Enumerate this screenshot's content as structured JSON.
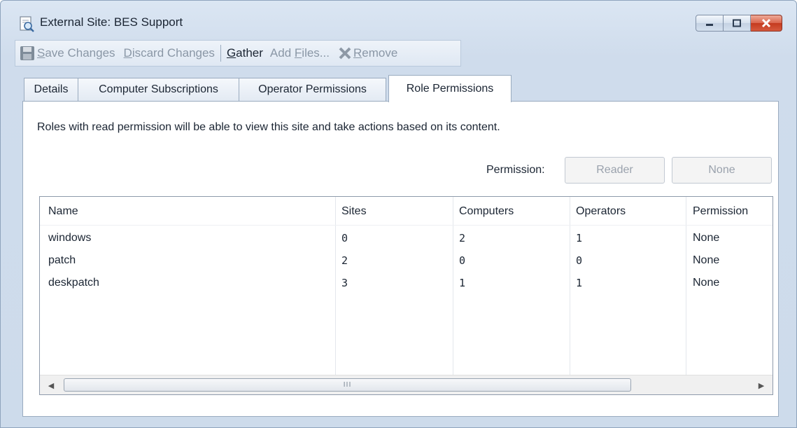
{
  "window": {
    "title": "External Site: BES Support"
  },
  "toolbar": {
    "save_label": "Save Changes",
    "discard_label": "Discard Changes",
    "gather_label": "Gather",
    "add_files_label": "Add Files...",
    "remove_label": "Remove"
  },
  "tabs": [
    {
      "label": "Details"
    },
    {
      "label": "Computer Subscriptions"
    },
    {
      "label": "Operator Permissions"
    },
    {
      "label": "Role Permissions"
    }
  ],
  "panel": {
    "description": "Roles with read permission will be able to view this site and take actions based on its content.",
    "permission_label": "Permission:",
    "reader_button": "Reader",
    "none_button": "None"
  },
  "table": {
    "columns": [
      "Name",
      "Sites",
      "Computers",
      "Operators",
      "Permission"
    ],
    "rows": [
      {
        "name": "windows",
        "sites": "0",
        "computers": "2",
        "operators": "1",
        "permission": "None"
      },
      {
        "name": "patch",
        "sites": "2",
        "computers": "0",
        "operators": "0",
        "permission": "None"
      },
      {
        "name": "deskpatch",
        "sites": "3",
        "computers": "1",
        "operators": "1",
        "permission": "None"
      }
    ]
  },
  "scrollbar": {
    "grip": "III"
  }
}
